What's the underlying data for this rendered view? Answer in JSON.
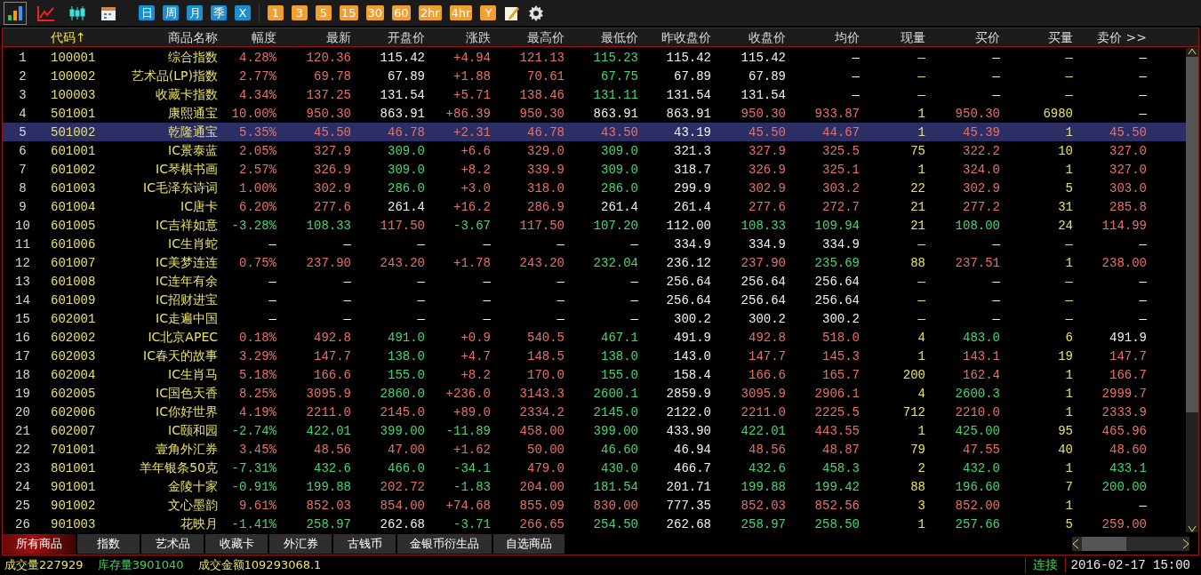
{
  "toolbar": {
    "chart_modes": [
      {
        "kind": "bars",
        "selected": true
      },
      {
        "kind": "line",
        "selected": false
      },
      {
        "kind": "candles",
        "selected": false
      },
      {
        "kind": "calendar",
        "selected": false
      }
    ],
    "periods": [
      {
        "label": "日",
        "kind": "blue"
      },
      {
        "label": "周",
        "kind": "blue"
      },
      {
        "label": "月",
        "kind": "blue"
      },
      {
        "label": "季",
        "kind": "blue"
      },
      {
        "label": "X",
        "kind": "blue"
      },
      {
        "label": "1",
        "kind": "orange"
      },
      {
        "label": "3",
        "kind": "orange"
      },
      {
        "label": "5",
        "kind": "orange"
      },
      {
        "label": "15",
        "kind": "orange"
      },
      {
        "label": "30",
        "kind": "orange"
      },
      {
        "label": "60",
        "kind": "orange"
      },
      {
        "label": "2hr",
        "kind": "orange"
      },
      {
        "label": "4hr",
        "kind": "orange"
      },
      {
        "label": "Y",
        "kind": "orange"
      }
    ],
    "tools": [
      {
        "kind": "note"
      },
      {
        "kind": "gear"
      }
    ]
  },
  "table": {
    "columns": [
      {
        "kind": "index"
      },
      {
        "label": "代码↑",
        "kind": "code",
        "sorted": true
      },
      {
        "label": "商品名称",
        "kind": "name",
        "sorted": false
      },
      {
        "label": "幅度",
        "kind": "number",
        "sorted": false
      },
      {
        "label": "最新",
        "kind": "number",
        "sorted": false
      },
      {
        "label": "开盘价",
        "kind": "number",
        "sorted": false
      },
      {
        "label": "涨跌",
        "kind": "number",
        "sorted": false
      },
      {
        "label": "最高价",
        "kind": "number",
        "sorted": false
      },
      {
        "label": "最低价",
        "kind": "number",
        "sorted": false
      },
      {
        "label": "昨收盘价",
        "kind": "number",
        "sorted": false
      },
      {
        "label": "收盘价",
        "kind": "number",
        "sorted": false
      },
      {
        "label": "均价",
        "kind": "number",
        "sorted": false
      },
      {
        "label": "现量",
        "kind": "number",
        "sorted": false
      },
      {
        "label": "买价",
        "kind": "number",
        "sorted": false
      },
      {
        "label": "买量",
        "kind": "number",
        "sorted": false
      },
      {
        "label": "卖价 >>",
        "kind": "number",
        "sorted": false
      }
    ],
    "rows": [
      {
        "selected": false,
        "cells": [
          {
            "text": "1"
          },
          {
            "text": "100001"
          },
          {
            "text": "综合指数"
          },
          {
            "text": "4.28%",
            "color": "#e8716a"
          },
          {
            "text": "120.36",
            "color": "#e8716a"
          },
          {
            "text": "115.42",
            "color": "#f0f0f0"
          },
          {
            "text": "+4.94",
            "color": "#e8716a"
          },
          {
            "text": "121.13",
            "color": "#e8716a"
          },
          {
            "text": "115.23",
            "color": "#43d870"
          },
          {
            "text": "115.42",
            "color": "#f0f0f0"
          },
          {
            "text": "115.42",
            "color": "#f0f0f0"
          },
          {
            "text": "—",
            "color": "#f0f0f0"
          },
          {
            "text": "—",
            "color": "#e8e06a"
          },
          {
            "text": "—",
            "color": "#f0f0f0"
          },
          {
            "text": "—",
            "color": "#e8e06a"
          },
          {
            "text": "—",
            "color": "#f0f0f0"
          }
        ]
      },
      {
        "selected": false,
        "cells": [
          {
            "text": "2"
          },
          {
            "text": "100002"
          },
          {
            "text": "艺术品(LP)指数"
          },
          {
            "text": "2.77%",
            "color": "#e8716a"
          },
          {
            "text": "69.78",
            "color": "#e8716a"
          },
          {
            "text": "67.89",
            "color": "#f0f0f0"
          },
          {
            "text": "+1.88",
            "color": "#e8716a"
          },
          {
            "text": "70.61",
            "color": "#e8716a"
          },
          {
            "text": "67.75",
            "color": "#43d870"
          },
          {
            "text": "67.89",
            "color": "#f0f0f0"
          },
          {
            "text": "67.89",
            "color": "#f0f0f0"
          },
          {
            "text": "—",
            "color": "#f0f0f0"
          },
          {
            "text": "—",
            "color": "#e8e06a"
          },
          {
            "text": "—",
            "color": "#f0f0f0"
          },
          {
            "text": "—",
            "color": "#e8e06a"
          },
          {
            "text": "—",
            "color": "#f0f0f0"
          }
        ]
      },
      {
        "selected": false,
        "cells": [
          {
            "text": "3"
          },
          {
            "text": "100003"
          },
          {
            "text": "收藏卡指数"
          },
          {
            "text": "4.34%",
            "color": "#e8716a"
          },
          {
            "text": "137.25",
            "color": "#e8716a"
          },
          {
            "text": "131.54",
            "color": "#f0f0f0"
          },
          {
            "text": "+5.71",
            "color": "#e8716a"
          },
          {
            "text": "138.46",
            "color": "#e8716a"
          },
          {
            "text": "131.11",
            "color": "#43d870"
          },
          {
            "text": "131.54",
            "color": "#f0f0f0"
          },
          {
            "text": "131.54",
            "color": "#f0f0f0"
          },
          {
            "text": "—",
            "color": "#f0f0f0"
          },
          {
            "text": "—",
            "color": "#e8e06a"
          },
          {
            "text": "—",
            "color": "#f0f0f0"
          },
          {
            "text": "—",
            "color": "#e8e06a"
          },
          {
            "text": "—",
            "color": "#f0f0f0"
          }
        ]
      },
      {
        "selected": false,
        "cells": [
          {
            "text": "4"
          },
          {
            "text": "501001"
          },
          {
            "text": "康熙通宝"
          },
          {
            "text": "10.00%",
            "color": "#e8716a"
          },
          {
            "text": "950.30",
            "color": "#e8716a"
          },
          {
            "text": "863.91",
            "color": "#f0f0f0"
          },
          {
            "text": "+86.39",
            "color": "#e8716a"
          },
          {
            "text": "950.30",
            "color": "#e8716a"
          },
          {
            "text": "863.91",
            "color": "#f0f0f0"
          },
          {
            "text": "863.91",
            "color": "#f0f0f0"
          },
          {
            "text": "950.30",
            "color": "#e8716a"
          },
          {
            "text": "933.87",
            "color": "#e8716a"
          },
          {
            "text": "1",
            "color": "#e8e06a"
          },
          {
            "text": "950.30",
            "color": "#e8716a"
          },
          {
            "text": "6980",
            "color": "#e8e06a"
          },
          {
            "text": "—",
            "color": "#f0f0f0"
          }
        ]
      },
      {
        "selected": true,
        "cells": [
          {
            "text": "5"
          },
          {
            "text": "501002"
          },
          {
            "text": "乾隆通宝"
          },
          {
            "text": "5.35%",
            "color": "#e8716a"
          },
          {
            "text": "45.50",
            "color": "#e8716a"
          },
          {
            "text": "46.78",
            "color": "#e8716a"
          },
          {
            "text": "+2.31",
            "color": "#e8716a"
          },
          {
            "text": "46.78",
            "color": "#e8716a"
          },
          {
            "text": "43.50",
            "color": "#e8716a"
          },
          {
            "text": "43.19",
            "color": "#f0f0f0"
          },
          {
            "text": "45.50",
            "color": "#e8716a"
          },
          {
            "text": "44.67",
            "color": "#e8716a"
          },
          {
            "text": "1",
            "color": "#e8e06a"
          },
          {
            "text": "45.39",
            "color": "#e8716a"
          },
          {
            "text": "1",
            "color": "#e8e06a"
          },
          {
            "text": "45.50",
            "color": "#e8716a"
          }
        ]
      },
      {
        "selected": false,
        "cells": [
          {
            "text": "6"
          },
          {
            "text": "601001"
          },
          {
            "text": "IC景泰蓝"
          },
          {
            "text": "2.05%",
            "color": "#e8716a"
          },
          {
            "text": "327.9",
            "color": "#e8716a"
          },
          {
            "text": "309.0",
            "color": "#43d870"
          },
          {
            "text": "+6.6",
            "color": "#e8716a"
          },
          {
            "text": "329.0",
            "color": "#e8716a"
          },
          {
            "text": "309.0",
            "color": "#43d870"
          },
          {
            "text": "321.3",
            "color": "#f0f0f0"
          },
          {
            "text": "327.9",
            "color": "#e8716a"
          },
          {
            "text": "325.5",
            "color": "#e8716a"
          },
          {
            "text": "75",
            "color": "#e8e06a"
          },
          {
            "text": "322.2",
            "color": "#e8716a"
          },
          {
            "text": "10",
            "color": "#e8e06a"
          },
          {
            "text": "327.0",
            "color": "#e8716a"
          }
        ]
      },
      {
        "selected": false,
        "cells": [
          {
            "text": "7"
          },
          {
            "text": "601002"
          },
          {
            "text": "IC琴棋书画"
          },
          {
            "text": "2.57%",
            "color": "#e8716a"
          },
          {
            "text": "326.9",
            "color": "#e8716a"
          },
          {
            "text": "309.0",
            "color": "#43d870"
          },
          {
            "text": "+8.2",
            "color": "#e8716a"
          },
          {
            "text": "339.9",
            "color": "#e8716a"
          },
          {
            "text": "309.0",
            "color": "#43d870"
          },
          {
            "text": "318.7",
            "color": "#f0f0f0"
          },
          {
            "text": "326.9",
            "color": "#e8716a"
          },
          {
            "text": "325.1",
            "color": "#e8716a"
          },
          {
            "text": "1",
            "color": "#e8e06a"
          },
          {
            "text": "324.0",
            "color": "#e8716a"
          },
          {
            "text": "1",
            "color": "#e8e06a"
          },
          {
            "text": "327.0",
            "color": "#e8716a"
          }
        ]
      },
      {
        "selected": false,
        "cells": [
          {
            "text": "8"
          },
          {
            "text": "601003"
          },
          {
            "text": "IC毛泽东诗词"
          },
          {
            "text": "1.00%",
            "color": "#e8716a"
          },
          {
            "text": "302.9",
            "color": "#e8716a"
          },
          {
            "text": "286.0",
            "color": "#43d870"
          },
          {
            "text": "+3.0",
            "color": "#e8716a"
          },
          {
            "text": "318.0",
            "color": "#e8716a"
          },
          {
            "text": "286.0",
            "color": "#43d870"
          },
          {
            "text": "299.9",
            "color": "#f0f0f0"
          },
          {
            "text": "302.9",
            "color": "#e8716a"
          },
          {
            "text": "303.2",
            "color": "#e8716a"
          },
          {
            "text": "22",
            "color": "#e8e06a"
          },
          {
            "text": "302.9",
            "color": "#e8716a"
          },
          {
            "text": "5",
            "color": "#e8e06a"
          },
          {
            "text": "303.0",
            "color": "#e8716a"
          }
        ]
      },
      {
        "selected": false,
        "cells": [
          {
            "text": "9"
          },
          {
            "text": "601004"
          },
          {
            "text": "IC唐卡"
          },
          {
            "text": "6.20%",
            "color": "#e8716a"
          },
          {
            "text": "277.6",
            "color": "#e8716a"
          },
          {
            "text": "261.4",
            "color": "#f0f0f0"
          },
          {
            "text": "+16.2",
            "color": "#e8716a"
          },
          {
            "text": "286.9",
            "color": "#e8716a"
          },
          {
            "text": "261.4",
            "color": "#f0f0f0"
          },
          {
            "text": "261.4",
            "color": "#f0f0f0"
          },
          {
            "text": "277.6",
            "color": "#e8716a"
          },
          {
            "text": "272.7",
            "color": "#e8716a"
          },
          {
            "text": "21",
            "color": "#e8e06a"
          },
          {
            "text": "277.2",
            "color": "#e8716a"
          },
          {
            "text": "31",
            "color": "#e8e06a"
          },
          {
            "text": "285.8",
            "color": "#e8716a"
          }
        ]
      },
      {
        "selected": false,
        "cells": [
          {
            "text": "10"
          },
          {
            "text": "601005"
          },
          {
            "text": "IC吉祥如意"
          },
          {
            "text": "-3.28%",
            "color": "#43d870"
          },
          {
            "text": "108.33",
            "color": "#43d870"
          },
          {
            "text": "117.50",
            "color": "#e8716a"
          },
          {
            "text": "-3.67",
            "color": "#43d870"
          },
          {
            "text": "117.50",
            "color": "#e8716a"
          },
          {
            "text": "107.20",
            "color": "#43d870"
          },
          {
            "text": "112.00",
            "color": "#f0f0f0"
          },
          {
            "text": "108.33",
            "color": "#43d870"
          },
          {
            "text": "109.94",
            "color": "#43d870"
          },
          {
            "text": "21",
            "color": "#e8e06a"
          },
          {
            "text": "108.00",
            "color": "#43d870"
          },
          {
            "text": "24",
            "color": "#e8e06a"
          },
          {
            "text": "114.99",
            "color": "#e8716a"
          }
        ]
      },
      {
        "selected": false,
        "cells": [
          {
            "text": "11"
          },
          {
            "text": "601006"
          },
          {
            "text": "IC生肖蛇"
          },
          {
            "text": "—",
            "color": "#f0f0f0"
          },
          {
            "text": "—",
            "color": "#f0f0f0"
          },
          {
            "text": "—",
            "color": "#f0f0f0"
          },
          {
            "text": "—",
            "color": "#f0f0f0"
          },
          {
            "text": "—",
            "color": "#f0f0f0"
          },
          {
            "text": "—",
            "color": "#f0f0f0"
          },
          {
            "text": "334.9",
            "color": "#f0f0f0"
          },
          {
            "text": "334.9",
            "color": "#f0f0f0"
          },
          {
            "text": "334.9",
            "color": "#f0f0f0"
          },
          {
            "text": "—",
            "color": "#e8e06a"
          },
          {
            "text": "—",
            "color": "#f0f0f0"
          },
          {
            "text": "—",
            "color": "#e8e06a"
          },
          {
            "text": "—",
            "color": "#f0f0f0"
          }
        ]
      },
      {
        "selected": false,
        "cells": [
          {
            "text": "12"
          },
          {
            "text": "601007"
          },
          {
            "text": "IC美梦连连"
          },
          {
            "text": "0.75%",
            "color": "#e8716a"
          },
          {
            "text": "237.90",
            "color": "#e8716a"
          },
          {
            "text": "243.20",
            "color": "#e8716a"
          },
          {
            "text": "+1.78",
            "color": "#e8716a"
          },
          {
            "text": "243.20",
            "color": "#e8716a"
          },
          {
            "text": "232.04",
            "color": "#43d870"
          },
          {
            "text": "236.12",
            "color": "#f0f0f0"
          },
          {
            "text": "237.90",
            "color": "#e8716a"
          },
          {
            "text": "235.69",
            "color": "#43d870"
          },
          {
            "text": "88",
            "color": "#e8e06a"
          },
          {
            "text": "237.51",
            "color": "#e8716a"
          },
          {
            "text": "1",
            "color": "#e8e06a"
          },
          {
            "text": "238.00",
            "color": "#e8716a"
          }
        ]
      },
      {
        "selected": false,
        "cells": [
          {
            "text": "13"
          },
          {
            "text": "601008"
          },
          {
            "text": "IC连年有余"
          },
          {
            "text": "—",
            "color": "#f0f0f0"
          },
          {
            "text": "—",
            "color": "#f0f0f0"
          },
          {
            "text": "—",
            "color": "#f0f0f0"
          },
          {
            "text": "—",
            "color": "#f0f0f0"
          },
          {
            "text": "—",
            "color": "#f0f0f0"
          },
          {
            "text": "—",
            "color": "#f0f0f0"
          },
          {
            "text": "256.64",
            "color": "#f0f0f0"
          },
          {
            "text": "256.64",
            "color": "#f0f0f0"
          },
          {
            "text": "256.64",
            "color": "#f0f0f0"
          },
          {
            "text": "—",
            "color": "#e8e06a"
          },
          {
            "text": "—",
            "color": "#f0f0f0"
          },
          {
            "text": "—",
            "color": "#e8e06a"
          },
          {
            "text": "—",
            "color": "#f0f0f0"
          }
        ]
      },
      {
        "selected": false,
        "cells": [
          {
            "text": "14"
          },
          {
            "text": "601009"
          },
          {
            "text": "IC招财进宝"
          },
          {
            "text": "—",
            "color": "#f0f0f0"
          },
          {
            "text": "—",
            "color": "#f0f0f0"
          },
          {
            "text": "—",
            "color": "#f0f0f0"
          },
          {
            "text": "—",
            "color": "#f0f0f0"
          },
          {
            "text": "—",
            "color": "#f0f0f0"
          },
          {
            "text": "—",
            "color": "#f0f0f0"
          },
          {
            "text": "256.64",
            "color": "#f0f0f0"
          },
          {
            "text": "256.64",
            "color": "#f0f0f0"
          },
          {
            "text": "256.64",
            "color": "#f0f0f0"
          },
          {
            "text": "—",
            "color": "#e8e06a"
          },
          {
            "text": "—",
            "color": "#f0f0f0"
          },
          {
            "text": "—",
            "color": "#e8e06a"
          },
          {
            "text": "—",
            "color": "#f0f0f0"
          }
        ]
      },
      {
        "selected": false,
        "cells": [
          {
            "text": "15"
          },
          {
            "text": "602001"
          },
          {
            "text": "IC走遍中国"
          },
          {
            "text": "—",
            "color": "#f0f0f0"
          },
          {
            "text": "—",
            "color": "#f0f0f0"
          },
          {
            "text": "—",
            "color": "#f0f0f0"
          },
          {
            "text": "—",
            "color": "#f0f0f0"
          },
          {
            "text": "—",
            "color": "#f0f0f0"
          },
          {
            "text": "—",
            "color": "#f0f0f0"
          },
          {
            "text": "300.2",
            "color": "#f0f0f0"
          },
          {
            "text": "300.2",
            "color": "#f0f0f0"
          },
          {
            "text": "300.2",
            "color": "#f0f0f0"
          },
          {
            "text": "—",
            "color": "#e8e06a"
          },
          {
            "text": "—",
            "color": "#f0f0f0"
          },
          {
            "text": "—",
            "color": "#e8e06a"
          },
          {
            "text": "—",
            "color": "#f0f0f0"
          }
        ]
      },
      {
        "selected": false,
        "cells": [
          {
            "text": "16"
          },
          {
            "text": "602002"
          },
          {
            "text": "IC北京APEC"
          },
          {
            "text": "0.18%",
            "color": "#e8716a"
          },
          {
            "text": "492.8",
            "color": "#e8716a"
          },
          {
            "text": "491.0",
            "color": "#43d870"
          },
          {
            "text": "+0.9",
            "color": "#e8716a"
          },
          {
            "text": "540.5",
            "color": "#e8716a"
          },
          {
            "text": "467.1",
            "color": "#43d870"
          },
          {
            "text": "491.9",
            "color": "#f0f0f0"
          },
          {
            "text": "492.8",
            "color": "#e8716a"
          },
          {
            "text": "518.0",
            "color": "#e8716a"
          },
          {
            "text": "4",
            "color": "#e8e06a"
          },
          {
            "text": "483.0",
            "color": "#43d870"
          },
          {
            "text": "6",
            "color": "#e8e06a"
          },
          {
            "text": "491.9",
            "color": "#f0f0f0"
          }
        ]
      },
      {
        "selected": false,
        "cells": [
          {
            "text": "17"
          },
          {
            "text": "602003"
          },
          {
            "text": "IC春天的故事"
          },
          {
            "text": "3.29%",
            "color": "#e8716a"
          },
          {
            "text": "147.7",
            "color": "#e8716a"
          },
          {
            "text": "138.0",
            "color": "#43d870"
          },
          {
            "text": "+4.7",
            "color": "#e8716a"
          },
          {
            "text": "148.5",
            "color": "#e8716a"
          },
          {
            "text": "138.0",
            "color": "#43d870"
          },
          {
            "text": "143.0",
            "color": "#f0f0f0"
          },
          {
            "text": "147.7",
            "color": "#e8716a"
          },
          {
            "text": "145.3",
            "color": "#e8716a"
          },
          {
            "text": "1",
            "color": "#e8e06a"
          },
          {
            "text": "143.1",
            "color": "#e8716a"
          },
          {
            "text": "19",
            "color": "#e8e06a"
          },
          {
            "text": "147.7",
            "color": "#e8716a"
          }
        ]
      },
      {
        "selected": false,
        "cells": [
          {
            "text": "18"
          },
          {
            "text": "602004"
          },
          {
            "text": "IC生肖马"
          },
          {
            "text": "5.18%",
            "color": "#e8716a"
          },
          {
            "text": "166.6",
            "color": "#e8716a"
          },
          {
            "text": "155.0",
            "color": "#43d870"
          },
          {
            "text": "+8.2",
            "color": "#e8716a"
          },
          {
            "text": "170.0",
            "color": "#e8716a"
          },
          {
            "text": "155.0",
            "color": "#43d870"
          },
          {
            "text": "158.4",
            "color": "#f0f0f0"
          },
          {
            "text": "166.6",
            "color": "#e8716a"
          },
          {
            "text": "165.7",
            "color": "#e8716a"
          },
          {
            "text": "200",
            "color": "#e8e06a"
          },
          {
            "text": "162.4",
            "color": "#e8716a"
          },
          {
            "text": "1",
            "color": "#e8e06a"
          },
          {
            "text": "166.7",
            "color": "#e8716a"
          }
        ]
      },
      {
        "selected": false,
        "cells": [
          {
            "text": "19"
          },
          {
            "text": "602005"
          },
          {
            "text": "IC国色天香"
          },
          {
            "text": "8.25%",
            "color": "#e8716a"
          },
          {
            "text": "3095.9",
            "color": "#e8716a"
          },
          {
            "text": "2860.0",
            "color": "#43d870"
          },
          {
            "text": "+236.0",
            "color": "#e8716a"
          },
          {
            "text": "3143.3",
            "color": "#e8716a"
          },
          {
            "text": "2600.1",
            "color": "#43d870"
          },
          {
            "text": "2859.9",
            "color": "#f0f0f0"
          },
          {
            "text": "3095.9",
            "color": "#e8716a"
          },
          {
            "text": "2906.1",
            "color": "#e8716a"
          },
          {
            "text": "4",
            "color": "#e8e06a"
          },
          {
            "text": "2600.3",
            "color": "#43d870"
          },
          {
            "text": "1",
            "color": "#e8e06a"
          },
          {
            "text": "2999.7",
            "color": "#e8716a"
          }
        ]
      },
      {
        "selected": false,
        "cells": [
          {
            "text": "20"
          },
          {
            "text": "602006"
          },
          {
            "text": "IC你好世界"
          },
          {
            "text": "4.19%",
            "color": "#e8716a"
          },
          {
            "text": "2211.0",
            "color": "#e8716a"
          },
          {
            "text": "2145.0",
            "color": "#e8716a"
          },
          {
            "text": "+89.0",
            "color": "#e8716a"
          },
          {
            "text": "2334.2",
            "color": "#e8716a"
          },
          {
            "text": "2145.0",
            "color": "#43d870"
          },
          {
            "text": "2122.0",
            "color": "#f0f0f0"
          },
          {
            "text": "2211.0",
            "color": "#e8716a"
          },
          {
            "text": "2225.5",
            "color": "#e8716a"
          },
          {
            "text": "712",
            "color": "#e8e06a"
          },
          {
            "text": "2210.0",
            "color": "#e8716a"
          },
          {
            "text": "1",
            "color": "#e8e06a"
          },
          {
            "text": "2333.9",
            "color": "#e8716a"
          }
        ]
      },
      {
        "selected": false,
        "cells": [
          {
            "text": "21"
          },
          {
            "text": "602007"
          },
          {
            "text": "IC颐和园"
          },
          {
            "text": "-2.74%",
            "color": "#43d870"
          },
          {
            "text": "422.01",
            "color": "#43d870"
          },
          {
            "text": "399.00",
            "color": "#43d870"
          },
          {
            "text": "-11.89",
            "color": "#43d870"
          },
          {
            "text": "458.00",
            "color": "#e8716a"
          },
          {
            "text": "399.00",
            "color": "#43d870"
          },
          {
            "text": "433.90",
            "color": "#f0f0f0"
          },
          {
            "text": "422.01",
            "color": "#43d870"
          },
          {
            "text": "443.55",
            "color": "#e8716a"
          },
          {
            "text": "1",
            "color": "#e8e06a"
          },
          {
            "text": "425.00",
            "color": "#43d870"
          },
          {
            "text": "95",
            "color": "#e8e06a"
          },
          {
            "text": "465.96",
            "color": "#e8716a"
          }
        ]
      },
      {
        "selected": false,
        "cells": [
          {
            "text": "22"
          },
          {
            "text": "701001"
          },
          {
            "text": "壹角外汇券"
          },
          {
            "text": "3.45%",
            "color": "#e8716a"
          },
          {
            "text": "48.56",
            "color": "#e8716a"
          },
          {
            "text": "47.00",
            "color": "#e8716a"
          },
          {
            "text": "+1.62",
            "color": "#e8716a"
          },
          {
            "text": "50.00",
            "color": "#e8716a"
          },
          {
            "text": "46.60",
            "color": "#43d870"
          },
          {
            "text": "46.94",
            "color": "#f0f0f0"
          },
          {
            "text": "48.56",
            "color": "#e8716a"
          },
          {
            "text": "48.87",
            "color": "#e8716a"
          },
          {
            "text": "79",
            "color": "#e8e06a"
          },
          {
            "text": "47.55",
            "color": "#e8716a"
          },
          {
            "text": "40",
            "color": "#e8e06a"
          },
          {
            "text": "48.60",
            "color": "#e8716a"
          }
        ]
      },
      {
        "selected": false,
        "cells": [
          {
            "text": "23"
          },
          {
            "text": "801001"
          },
          {
            "text": "羊年银条50克"
          },
          {
            "text": "-7.31%",
            "color": "#43d870"
          },
          {
            "text": "432.6",
            "color": "#43d870"
          },
          {
            "text": "466.0",
            "color": "#43d870"
          },
          {
            "text": "-34.1",
            "color": "#43d870"
          },
          {
            "text": "479.0",
            "color": "#e8716a"
          },
          {
            "text": "430.0",
            "color": "#43d870"
          },
          {
            "text": "466.7",
            "color": "#f0f0f0"
          },
          {
            "text": "432.6",
            "color": "#43d870"
          },
          {
            "text": "458.3",
            "color": "#43d870"
          },
          {
            "text": "2",
            "color": "#e8e06a"
          },
          {
            "text": "432.0",
            "color": "#43d870"
          },
          {
            "text": "1",
            "color": "#e8e06a"
          },
          {
            "text": "433.1",
            "color": "#43d870"
          }
        ]
      },
      {
        "selected": false,
        "cells": [
          {
            "text": "24"
          },
          {
            "text": "901001"
          },
          {
            "text": "金陵十家"
          },
          {
            "text": "-0.91%",
            "color": "#43d870"
          },
          {
            "text": "199.88",
            "color": "#43d870"
          },
          {
            "text": "202.72",
            "color": "#e8716a"
          },
          {
            "text": "-1.83",
            "color": "#43d870"
          },
          {
            "text": "204.00",
            "color": "#e8716a"
          },
          {
            "text": "181.54",
            "color": "#43d870"
          },
          {
            "text": "201.71",
            "color": "#f0f0f0"
          },
          {
            "text": "199.88",
            "color": "#43d870"
          },
          {
            "text": "199.42",
            "color": "#43d870"
          },
          {
            "text": "88",
            "color": "#e8e06a"
          },
          {
            "text": "196.60",
            "color": "#43d870"
          },
          {
            "text": "7",
            "color": "#e8e06a"
          },
          {
            "text": "200.00",
            "color": "#43d870"
          }
        ]
      },
      {
        "selected": false,
        "cells": [
          {
            "text": "25"
          },
          {
            "text": "901002"
          },
          {
            "text": "文心墨韵"
          },
          {
            "text": "9.61%",
            "color": "#e8716a"
          },
          {
            "text": "852.03",
            "color": "#e8716a"
          },
          {
            "text": "854.00",
            "color": "#e8716a"
          },
          {
            "text": "+74.68",
            "color": "#e8716a"
          },
          {
            "text": "855.09",
            "color": "#e8716a"
          },
          {
            "text": "830.00",
            "color": "#e8716a"
          },
          {
            "text": "777.35",
            "color": "#f0f0f0"
          },
          {
            "text": "852.03",
            "color": "#e8716a"
          },
          {
            "text": "852.56",
            "color": "#e8716a"
          },
          {
            "text": "3",
            "color": "#e8e06a"
          },
          {
            "text": "852.00",
            "color": "#e8716a"
          },
          {
            "text": "1",
            "color": "#e8e06a"
          },
          {
            "text": "—",
            "color": "#f0f0f0"
          }
        ]
      },
      {
        "selected": false,
        "cells": [
          {
            "text": "26"
          },
          {
            "text": "901003"
          },
          {
            "text": "花映月"
          },
          {
            "text": "-1.41%",
            "color": "#43d870"
          },
          {
            "text": "258.97",
            "color": "#43d870"
          },
          {
            "text": "262.68",
            "color": "#f0f0f0"
          },
          {
            "text": "-3.71",
            "color": "#43d870"
          },
          {
            "text": "266.65",
            "color": "#e8716a"
          },
          {
            "text": "254.50",
            "color": "#43d870"
          },
          {
            "text": "262.68",
            "color": "#f0f0f0"
          },
          {
            "text": "258.97",
            "color": "#43d870"
          },
          {
            "text": "258.50",
            "color": "#43d870"
          },
          {
            "text": "1",
            "color": "#e8e06a"
          },
          {
            "text": "257.66",
            "color": "#43d870"
          },
          {
            "text": "5",
            "color": "#e8e06a"
          },
          {
            "text": "259.00",
            "color": "#e8716a"
          }
        ]
      }
    ]
  },
  "tabs": [
    {
      "label": "所有商品",
      "selected": true
    },
    {
      "label": "指数",
      "selected": false
    },
    {
      "label": "艺术品",
      "selected": false
    },
    {
      "label": "收藏卡",
      "selected": false
    },
    {
      "label": "外汇券",
      "selected": false
    },
    {
      "label": "古钱币",
      "selected": false
    },
    {
      "label": "金银币衍生品",
      "selected": false
    },
    {
      "label": "自选商品",
      "selected": false
    }
  ],
  "status_bar": {
    "stats": [
      {
        "text": "成交量227929",
        "color": "#e8e06a"
      },
      {
        "text": "库存量3901040",
        "color": "#3fd45a"
      },
      {
        "text": "成交金额109293068.1",
        "color": "#e8e06a"
      }
    ],
    "connection": "连接",
    "datetime": "2016-02-17 15:00"
  }
}
